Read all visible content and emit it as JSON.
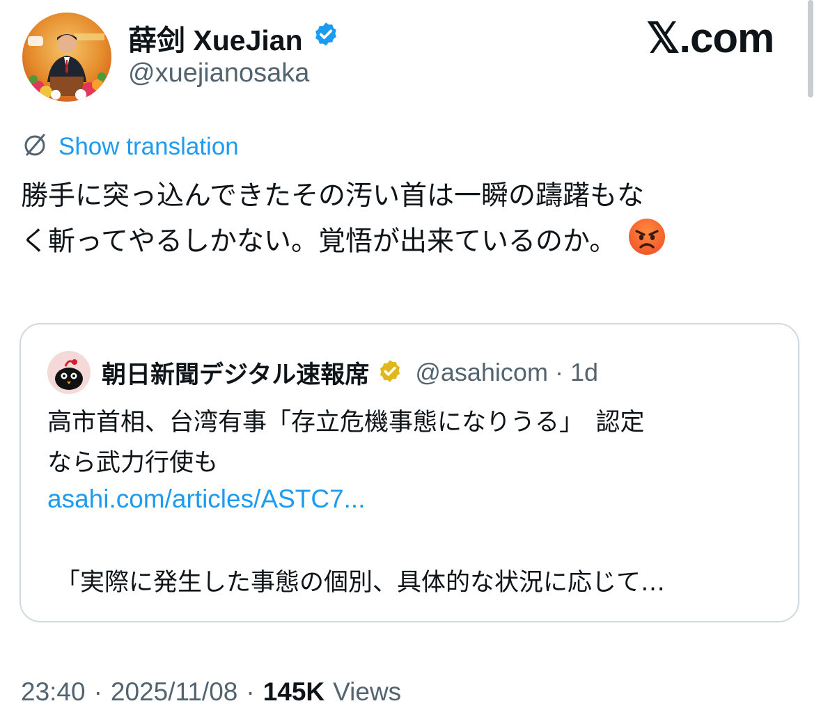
{
  "author": {
    "display_name": "薛剑 XueJian",
    "handle": "@xuejianosaka",
    "verified_badge_icon": "verified-badge-icon",
    "badge_color": "#1d9bf0"
  },
  "site_mark": "𝕏.com",
  "translation": {
    "icon": "translate-icon",
    "label": "Show translation"
  },
  "tweet": {
    "lines": [
      "勝手に突っ込んできたその汚い首は一瞬の躊躇もな",
      "く斬ってやるしかない。覚悟が出来ているのか。"
    ],
    "emoji": "angry-face-icon"
  },
  "quoted": {
    "name": "朝日新聞デジタル速報席",
    "handle": "@asahicom",
    "dot": "·",
    "time": "1d",
    "badge_color": "#e2b719",
    "text_lines": [
      "高市首相、台湾有事「存立危機事態になりうる」　認定",
      "なら武力行使も"
    ],
    "link": "asahi.com/articles/ASTC7...",
    "snippet": "「実際に発生した事態の個別、具体的な状況に応じて…"
  },
  "meta": {
    "time": "23:40",
    "dot1": "·",
    "date": "2025/11/08",
    "dot2": "·",
    "views_count": "145K",
    "views_label": "Views"
  },
  "colors": {
    "accent": "#1d9bf0",
    "text": "#0f1419",
    "muted": "#536471",
    "border": "#cfd9de"
  }
}
